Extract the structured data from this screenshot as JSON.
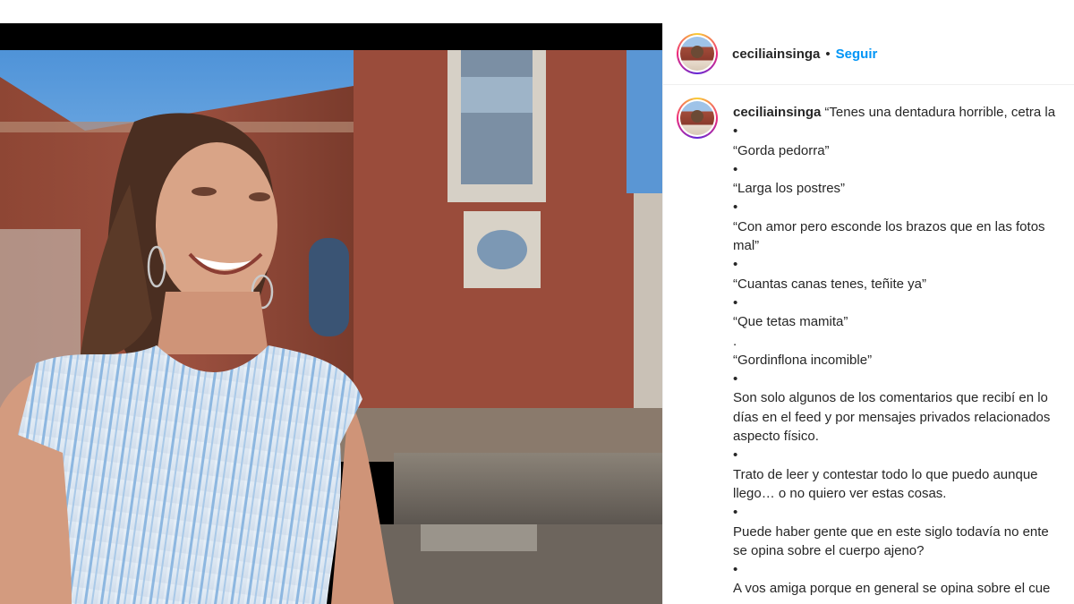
{
  "header": {
    "username": "ceciliainsinga",
    "separator": "•",
    "follow_label": "Seguir"
  },
  "caption": {
    "username": "ceciliainsinga",
    "lines": [
      "“Tenes una dentadura horrible, cetra la",
      "•",
      "“Gorda pedorra”",
      "•",
      "“Larga los postres”",
      "•",
      "“Con amor pero esconde los brazos que en las fotos",
      "mal”",
      "•",
      "“Cuantas canas tenes, teñite ya”",
      "•",
      "“Que tetas mamita”",
      ".",
      "“Gordinflona incomible”",
      "•",
      "Son solo algunos de los comentarios que recibí en lo",
      "días en el feed y por mensajes privados relacionados",
      "aspecto físico.",
      "•",
      "Trato de leer y contestar todo lo que puedo aunque",
      "llego… o no quiero ver estas cosas.",
      "•",
      "Puede haber gente que en este siglo todavía no ente",
      "se opina sobre el cuerpo ajeno?",
      "•",
      "A vos amiga porque en general se opina sobre el cue"
    ]
  },
  "colors": {
    "follow": "#0095f6",
    "text": "#262626",
    "border": "#efefef"
  }
}
